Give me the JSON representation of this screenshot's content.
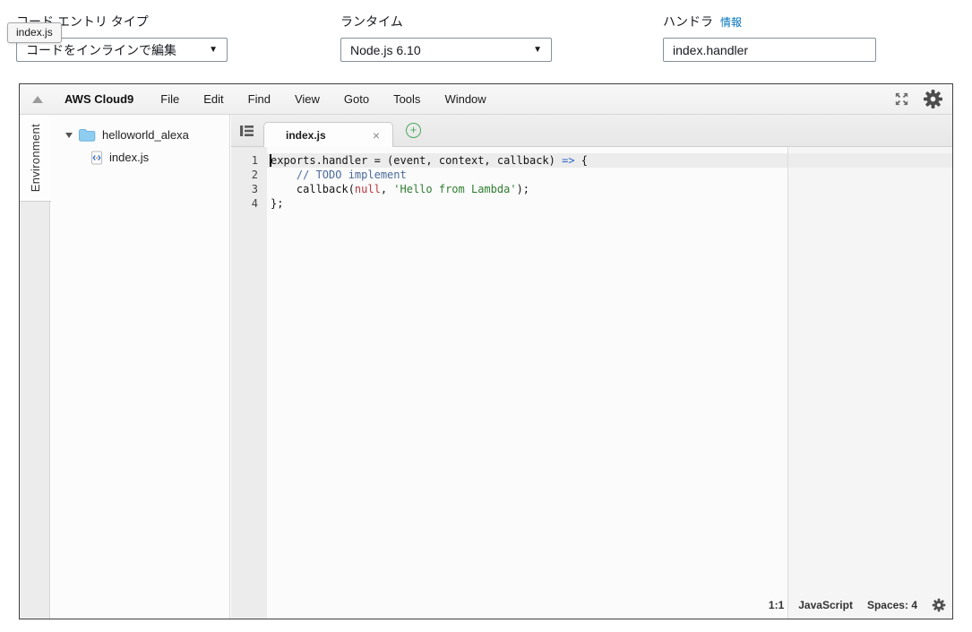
{
  "form": {
    "tooltip": "index.js",
    "code_entry": {
      "label": "コード エントリ タイプ",
      "value": "コードをインラインで編集"
    },
    "runtime": {
      "label": "ランタイム",
      "value": "Node.js 6.10"
    },
    "handler": {
      "label": "ハンドラ",
      "info": "情報",
      "value": "index.handler"
    }
  },
  "ide": {
    "menubar": {
      "brand": "AWS Cloud9",
      "items": [
        "File",
        "Edit",
        "Find",
        "View",
        "Goto",
        "Tools",
        "Window"
      ]
    },
    "sidebar_tab": "Environment",
    "tree": {
      "folder": "helloworld_alexa",
      "file": "index.js"
    },
    "tab": {
      "label": "index.js",
      "close": "×",
      "new_tab": "+"
    },
    "editor": {
      "lines": [
        {
          "num": "1",
          "active": true,
          "tokens": [
            {
              "t": "exports.handler = (event, context, callback) ",
              "c": "plain"
            },
            {
              "t": "=>",
              "c": "keyword"
            },
            {
              "t": " {",
              "c": "plain"
            }
          ]
        },
        {
          "num": "2",
          "active": false,
          "tokens": [
            {
              "t": "    ",
              "c": "plain"
            },
            {
              "t": "// TODO implement",
              "c": "comment"
            }
          ]
        },
        {
          "num": "3",
          "active": false,
          "tokens": [
            {
              "t": "    callback(",
              "c": "plain"
            },
            {
              "t": "null",
              "c": "constant"
            },
            {
              "t": ", ",
              "c": "plain"
            },
            {
              "t": "'Hello from Lambda'",
              "c": "string"
            },
            {
              "t": ");",
              "c": "plain"
            }
          ]
        },
        {
          "num": "4",
          "active": false,
          "tokens": [
            {
              "t": "};",
              "c": "plain"
            }
          ]
        }
      ]
    },
    "statusbar": {
      "cursor": "1:1",
      "language": "JavaScript",
      "indent": "Spaces: 4"
    }
  },
  "icons": {
    "menubar_left": "collapse-triangle-icon",
    "menubar_right": [
      "fullscreen-expand-icon",
      "gear-icon"
    ],
    "tree": [
      "disclosure-triangle-icon",
      "folder-icon",
      "js-file-icon"
    ],
    "tabbar": [
      "tab-list-icon",
      "close-icon",
      "plus-circle-icon"
    ],
    "statusbar": [
      "gear-icon"
    ]
  },
  "colors": {
    "link": "#0073bb",
    "frame_border": "#404040",
    "folder_fill": "#8fcdf0",
    "plus_green": "#49a85c",
    "syntax": {
      "plain": "#141414",
      "keyword": "#2d63c8",
      "comment": "#4a6b9b",
      "constant": "#b8383d",
      "string": "#2f7d31"
    }
  }
}
